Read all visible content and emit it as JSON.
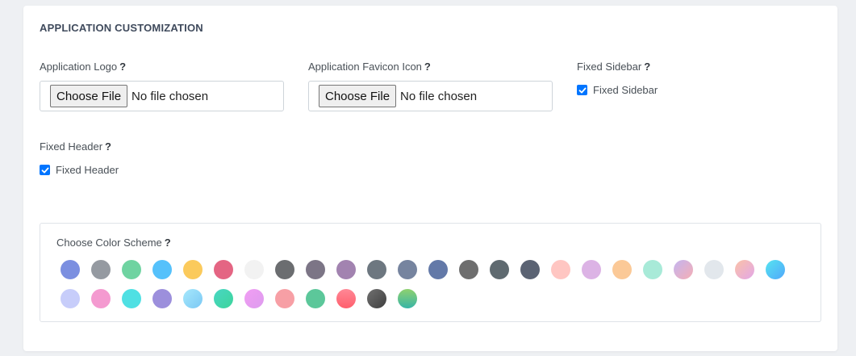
{
  "section": {
    "title": "APPLICATION CUSTOMIZATION"
  },
  "logo": {
    "label": "Application Logo",
    "help": "?",
    "button": "Choose File",
    "status": "No file chosen"
  },
  "favicon": {
    "label": "Application Favicon Icon",
    "help": "?",
    "button": "Choose File",
    "status": "No file chosen"
  },
  "fixed_sidebar": {
    "label": "Fixed Sidebar",
    "help": "?",
    "checkbox_label": "Fixed Sidebar",
    "checked": true
  },
  "fixed_header": {
    "label": "Fixed Header",
    "help": "?",
    "checkbox_label": "Fixed Header",
    "checked": true
  },
  "color_scheme": {
    "label": "Choose Color Scheme",
    "help": "?",
    "swatches": [
      "#7b8fe0",
      "#959aa1",
      "#6fd3a1",
      "#55c1fb",
      "#fbca5c",
      "#e46583",
      "#f2f2f2",
      "#6b6d70",
      "#7c7586",
      "#a283b0",
      "#6d7780",
      "#76849f",
      "#6379a8",
      "#6e6e6e",
      "#5f6a70",
      "#5b6373",
      "#ffc6c2",
      "#dcb3e5",
      "#fbc997",
      "#a8ead8",
      "linear-gradient(135deg,#c4b5f0,#f5aeb4)",
      "#e2e7ec",
      "linear-gradient(135deg,#fbc2a7,#e2a7e8)",
      "linear-gradient(135deg,#56e4f0,#51a7fb)",
      "#c7cdfa",
      "#f49ad0",
      "#4fe0e3",
      "#9c8fdc",
      "linear-gradient(135deg,#a6e8fc,#7bc8f4)",
      "linear-gradient(135deg,#49d6c4,#3dd59b)",
      "linear-gradient(135deg,#f19df3,#dd9cee)",
      "#f79fa5",
      "#5cc79a",
      "linear-gradient(180deg,#ff8896,#ff5f6d)",
      "linear-gradient(135deg,#707070,#3f3f3f)",
      "linear-gradient(180deg,#8fd16f,#38b5a7)"
    ]
  }
}
